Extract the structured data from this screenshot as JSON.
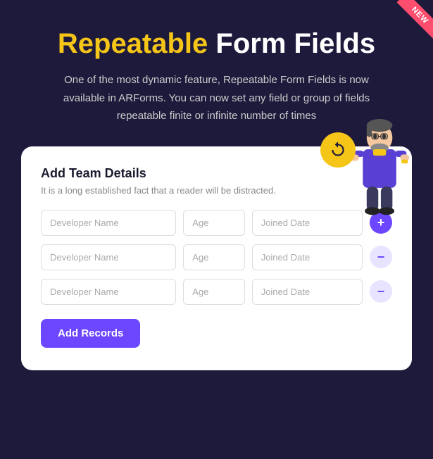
{
  "badge": {
    "label": "NEW"
  },
  "header": {
    "title_highlight": "Repeatable",
    "title_rest": " Form Fields",
    "subtitle": "One of the most dynamic feature, Repeatable Form Fields is now available in ARForms. You can now set any field or group of fields repeatable finite or infinite number of times"
  },
  "card": {
    "title": "Add Team Details",
    "subtitle": "It is a long established fact that a reader will be distracted.",
    "rows": [
      {
        "name_placeholder": "Developer Name",
        "age_placeholder": "Age",
        "date_placeholder": "Joined Date",
        "action": "add"
      },
      {
        "name_placeholder": "Developer Name",
        "age_placeholder": "Age",
        "date_placeholder": "Joined Date",
        "action": "remove"
      },
      {
        "name_placeholder": "Developer Name",
        "age_placeholder": "Age",
        "date_placeholder": "Joined Date",
        "action": "remove"
      }
    ],
    "add_records_label": "Add Records"
  },
  "colors": {
    "accent_purple": "#6c47ff",
    "accent_yellow": "#f5c518",
    "bg_dark": "#1e1a3c",
    "badge_red": "#ff4d6d"
  }
}
